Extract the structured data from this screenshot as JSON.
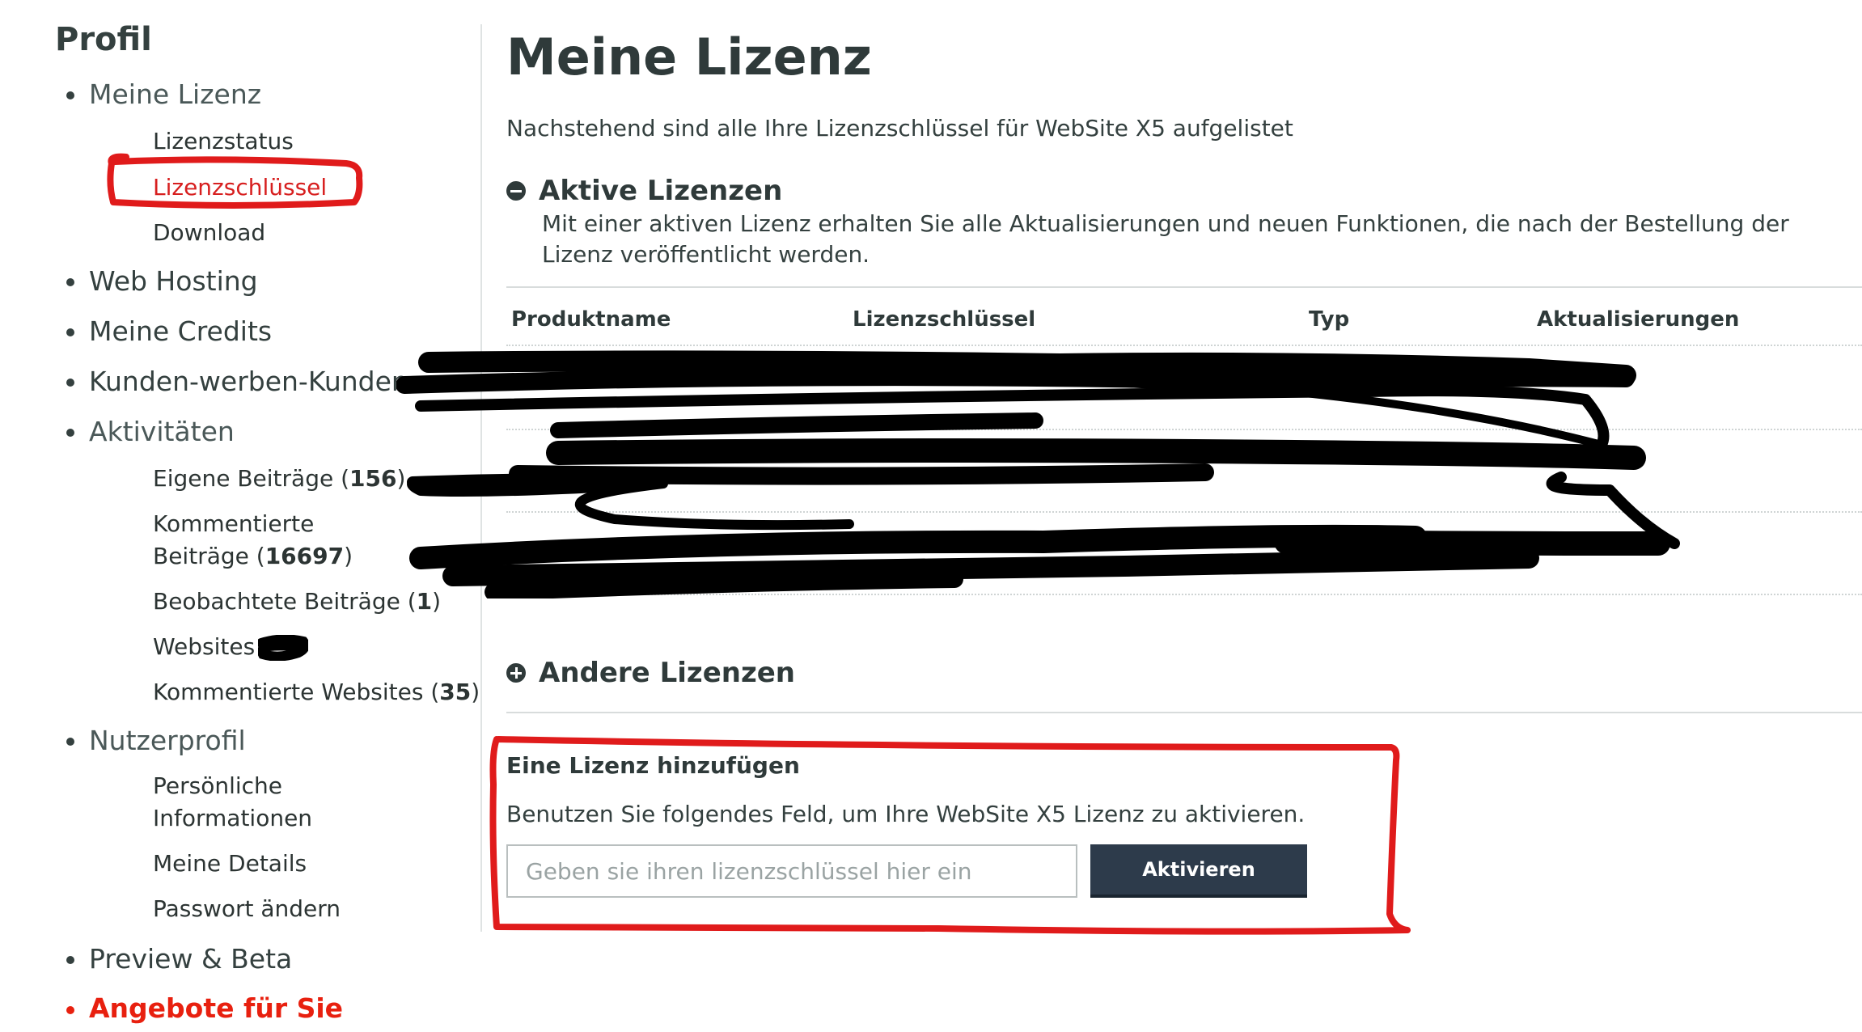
{
  "sidebar": {
    "title": "Profil",
    "items": [
      {
        "label": "Meine Lizenz"
      },
      {
        "label": "Web Hosting"
      },
      {
        "label": "Meine Credits"
      },
      {
        "label": "Kunden-werben-Kunden"
      },
      {
        "label": "Aktivitäten"
      },
      {
        "label": "Nutzerprofil"
      },
      {
        "label": "Preview & Beta"
      },
      {
        "label": "Angebote für Sie"
      }
    ],
    "license_sub": [
      "Lizenzstatus",
      "Lizenzschlüssel",
      "Download"
    ],
    "activities_sub": [
      {
        "label": "Eigene Beiträge",
        "count": "156"
      },
      {
        "label_line1": "Kommentierte",
        "label_line2": "Beiträge",
        "count": "16697"
      },
      {
        "label": "Beobachtete Beiträge",
        "count": "1"
      },
      {
        "label": "Websites"
      },
      {
        "label": "Kommentierte Websites",
        "count": "35"
      }
    ],
    "profile_sub": [
      {
        "line1": "Persönliche",
        "line2": "Informationen"
      },
      {
        "label": "Meine Details"
      },
      {
        "label": "Passwort ändern"
      }
    ]
  },
  "main": {
    "title": "Meine Lizenz",
    "intro": "Nachstehend sind alle Ihre Lizenzschlüssel für WebSite X5 aufgelistet",
    "active_section": {
      "title": "Aktive Lizenzen",
      "description": "Mit einer aktiven Lizenz erhalten Sie alle Aktualisierungen und neuen Funktionen, die nach der Bestellung der Lizenz veröffentlicht werden."
    },
    "table": {
      "columns": [
        "Produktname",
        "Lizenzschlüssel",
        "Typ",
        "Aktualisierungen"
      ]
    },
    "other_section": {
      "title": "Andere Lizenzen"
    },
    "add_license": {
      "title": "Eine Lizenz hinzufügen",
      "description": "Benutzen Sie folgendes Feld, um Ihre WebSite X5 Lizenz zu aktivieren.",
      "placeholder": "Geben sie ihren lizenzschlüssel hier ein",
      "button": "Aktivieren"
    }
  },
  "colors": {
    "accent_red": "#e8200f",
    "annotation_red": "#e01b1b",
    "button_bg": "#2d3b4b",
    "text_dark": "#2f3a3a"
  }
}
